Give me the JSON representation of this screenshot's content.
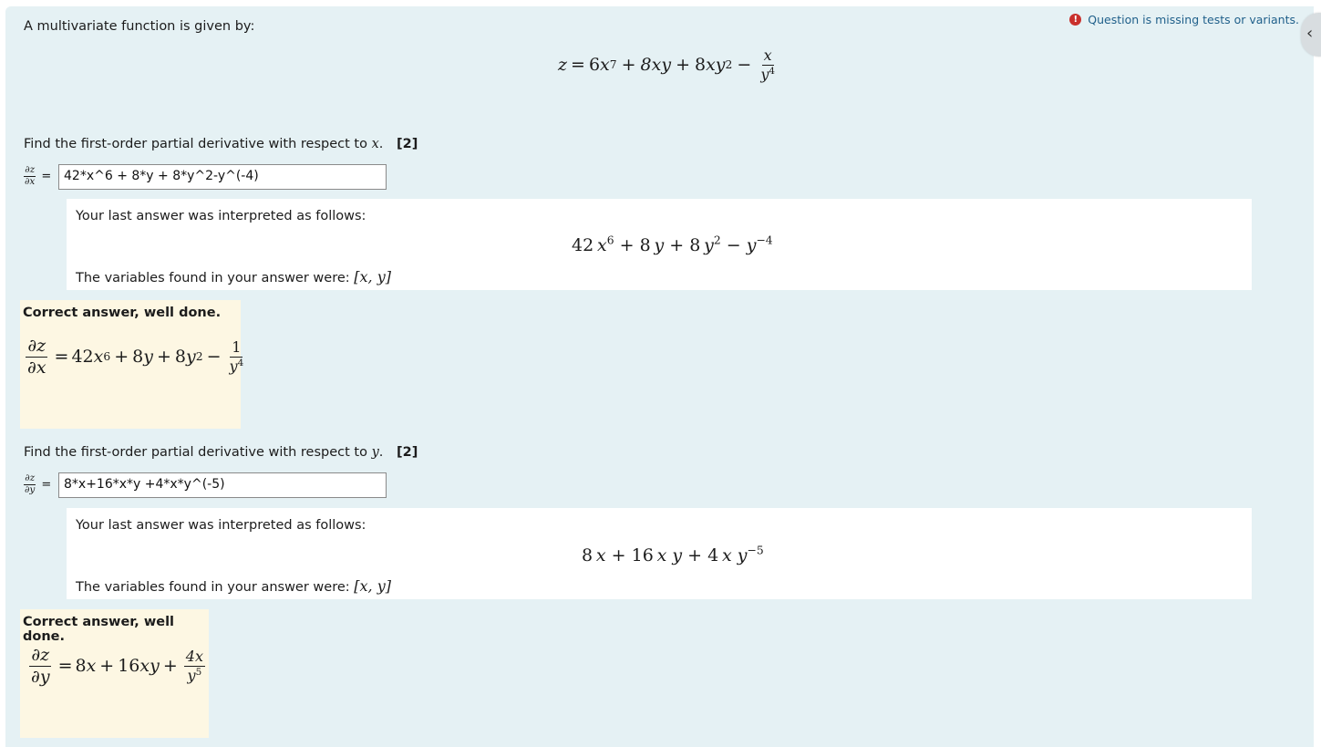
{
  "warning": {
    "text": "Question is missing tests or variants.",
    "icon": "exclamation-circle-icon",
    "color": "#c9302c"
  },
  "intro": "A multivariate function is given by:",
  "main_equation": {
    "lhs": "z",
    "t1_coef": "6",
    "t1_var": "x",
    "t1_exp": "7",
    "t2": "8xy",
    "t3_coef": "8",
    "t3_var": "xy",
    "t3_exp": "2",
    "frac_num": "x",
    "frac_den_var": "y",
    "frac_den_exp": "4"
  },
  "part1": {
    "prompt_text": "Find the first-order partial derivative with respect to",
    "prompt_var": "x",
    "prompt_end": ".",
    "marks": "[2]",
    "label_num": "∂z",
    "label_den": "∂x",
    "equals": "=",
    "input_value": "42*x^6 + 8*y + 8*y^2-y^(-4)",
    "interpreted_label": "Your last answer was interpreted as follows:",
    "interpreted": {
      "c1": "42",
      "v1": "x",
      "e1": "6",
      "c2": "8",
      "v2": "y",
      "c3": "8",
      "v3": "y",
      "e3": "2",
      "v4": "y",
      "e4": "−4"
    },
    "variables_label": "The variables found in your answer were:",
    "variables": "[x, y]",
    "feedback_title": "Correct answer, well done.",
    "answer": {
      "lhs_num": "∂z",
      "lhs_den": "∂x",
      "c1": "42",
      "v1": "x",
      "e1": "6",
      "c2": "8",
      "v2": "y",
      "c3": "8",
      "v3": "y",
      "e3": "2",
      "f_num": "1",
      "f_den_var": "y",
      "f_den_exp": "4"
    }
  },
  "part2": {
    "prompt_text": "Find the first-order partial derivative with respect to",
    "prompt_var": "y",
    "prompt_end": ".",
    "marks": "[2]",
    "label_num": "∂z",
    "label_den": "∂y",
    "equals": "=",
    "input_value": "8*x+16*x*y +4*x*y^(-5)",
    "interpreted_label": "Your last answer was interpreted as follows:",
    "interpreted": {
      "c1": "8",
      "v1": "x",
      "c2": "16",
      "v2": "x y",
      "c3": "4",
      "v3": "x y",
      "e3": "−5"
    },
    "variables_label": "The variables found in your answer were:",
    "variables": "[x, y]",
    "feedback_title": "Correct answer, well done.",
    "answer": {
      "lhs_num": "∂z",
      "lhs_den": "∂y",
      "c1": "8",
      "v1": "x",
      "c2": "16",
      "v2": "xy",
      "f_num": "4x",
      "f_den_var": "y",
      "f_den_exp": "5"
    }
  },
  "colors": {
    "panel_bg": "#e5f1f4",
    "feedback_bg": "#fdf7e3",
    "link": "#1f5f8a"
  }
}
